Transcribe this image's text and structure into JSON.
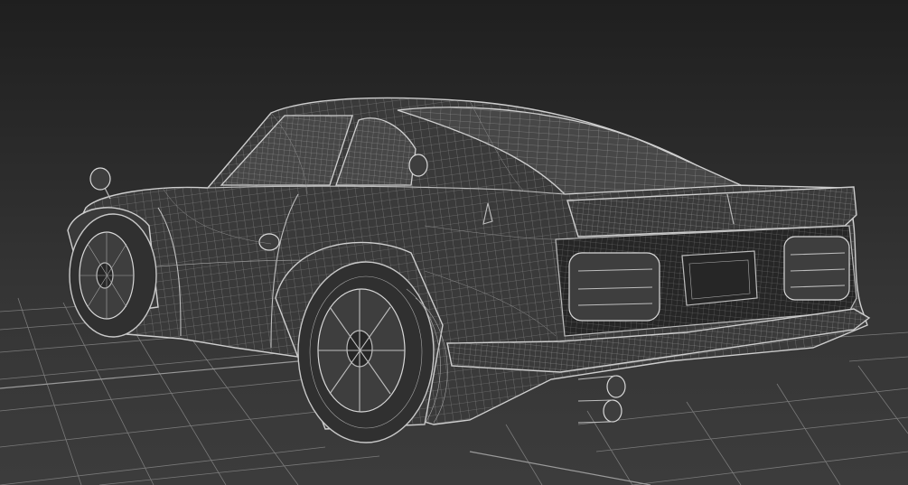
{
  "viewport": {
    "background_top": "#1f1f1f",
    "background_bottom": "#3c3c3c",
    "wire_color": "#bdbdbd",
    "grid_color": "#7a7a7a",
    "render_mode": "wireframe"
  },
  "scene": {
    "objects": [
      {
        "name": "sports-car-model",
        "shading": "wireframe"
      },
      {
        "name": "ground-grid",
        "shading": "lines"
      }
    ]
  }
}
